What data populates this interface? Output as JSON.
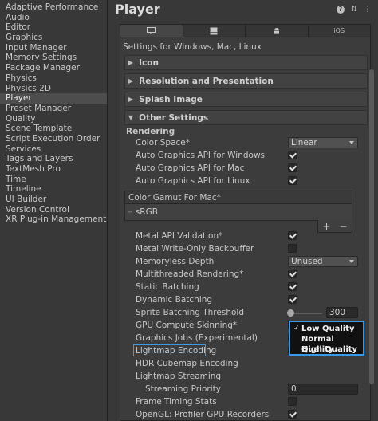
{
  "sidebar": {
    "items": [
      "Adaptive Performance",
      "Audio",
      "Editor",
      "Graphics",
      "Input Manager",
      "Memory Settings",
      "Package Manager",
      "Physics",
      "Physics 2D",
      "Player",
      "Preset Manager",
      "Quality",
      "Scene Template",
      "Script Execution Order",
      "Services",
      "Tags and Layers",
      "TextMesh Pro",
      "Time",
      "Timeline",
      "UI Builder",
      "Version Control",
      "XR Plug-in Management"
    ],
    "selected": "Player"
  },
  "header": {
    "title": "Player",
    "icons": [
      "help-icon",
      "preset-icon",
      "menu-icon"
    ]
  },
  "tabs": [
    {
      "label": "",
      "icon": "desktop-icon"
    },
    {
      "label": "",
      "icon": "server-icon"
    },
    {
      "label": "",
      "icon": "android-icon"
    },
    {
      "label": "iOS",
      "icon": ""
    }
  ],
  "settings_for": "Settings for Windows, Mac, Linux",
  "sections": {
    "icon": "Icon",
    "resolution": "Resolution and Presentation",
    "splash": "Splash Image",
    "other": "Other Settings"
  },
  "rendering": {
    "header": "Rendering",
    "color_space_label": "Color Space*",
    "color_space_value": "Linear",
    "auto_gfx_windows": "Auto Graphics API  for Windows",
    "auto_gfx_mac": "Auto Graphics API  for Mac",
    "auto_gfx_linux": "Auto Graphics API  for Linux",
    "gamut_header": "Color Gamut For Mac*",
    "gamut_item": "sRGB",
    "add_label": "+",
    "remove_label": "−",
    "metal_validation": "Metal API Validation*",
    "metal_backbuffer": "Metal Write-Only Backbuffer",
    "memoryless_label": "Memoryless Depth",
    "memoryless_value": "Unused",
    "multithreaded": "Multithreaded Rendering*",
    "static_batching": "Static Batching",
    "dynamic_batching": "Dynamic Batching",
    "sprite_threshold_label": "Sprite Batching Threshold",
    "sprite_threshold_value": "300",
    "gpu_skinning": "GPU Compute Skinning*",
    "graphics_jobs": "Graphics Jobs (Experimental)",
    "lightmap_encoding": "Lightmap Encoding",
    "hdr_cubemap": "HDR Cubemap Encoding",
    "lightmap_streaming": "Lightmap Streaming",
    "streaming_priority_label": "Streaming Priority",
    "streaming_priority_value": "0",
    "frame_timing": "Frame Timing Stats",
    "opengl_profiler": "OpenGL: Profiler GPU Recorders"
  },
  "popup": {
    "options": [
      "Low Quality",
      "Normal Quality",
      "High Quality"
    ],
    "selected": "Low Quality"
  },
  "colors": {
    "highlight": "#3a9ae8"
  }
}
